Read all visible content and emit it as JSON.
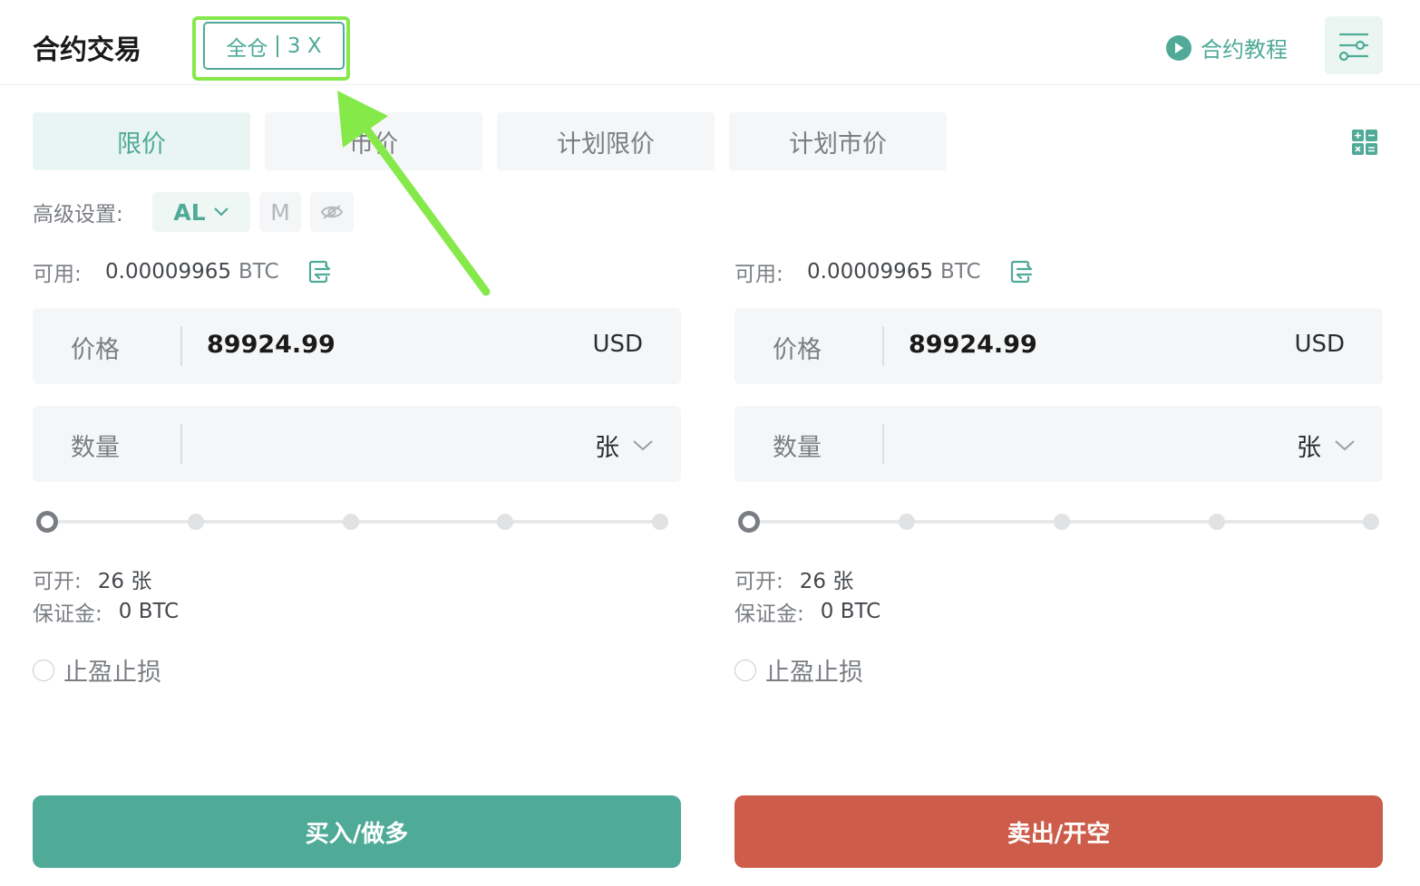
{
  "header": {
    "title": "合约交易",
    "margin_mode": "全仓",
    "leverage": "3 X",
    "tutorial_label": "合约教程"
  },
  "order_tabs": [
    {
      "label": "限价",
      "active": true
    },
    {
      "label": "市价",
      "active": false
    },
    {
      "label": "计划限价",
      "active": false
    },
    {
      "label": "计划市价",
      "active": false
    }
  ],
  "advanced": {
    "label": "高级设置:",
    "al_label": "AL",
    "m_label": "M"
  },
  "buy_panel": {
    "available_label": "可用:",
    "available_value": "0.00009965",
    "available_unit": "BTC",
    "price_label": "价格",
    "price_value": "89924.99",
    "price_unit": "USD",
    "qty_label": "数量",
    "qty_unit": "张",
    "slider_percent": 0,
    "openable_label": "可开:",
    "openable_value": "26 张",
    "margin_label": "保证金:",
    "margin_value": "0 BTC",
    "tpsl_label": "止盈止损",
    "action_label": "买入/做多"
  },
  "sell_panel": {
    "available_label": "可用:",
    "available_value": "0.00009965",
    "available_unit": "BTC",
    "price_label": "价格",
    "price_value": "89924.99",
    "price_unit": "USD",
    "qty_label": "数量",
    "qty_unit": "张",
    "slider_percent": 0,
    "openable_label": "可开:",
    "openable_value": "26 张",
    "margin_label": "保证金:",
    "margin_value": "0 BTC",
    "tpsl_label": "止盈止损",
    "action_label": "卖出/开空"
  },
  "colors": {
    "accent": "#4faa98",
    "sell": "#cd5d4a",
    "highlight": "#86e94a"
  }
}
